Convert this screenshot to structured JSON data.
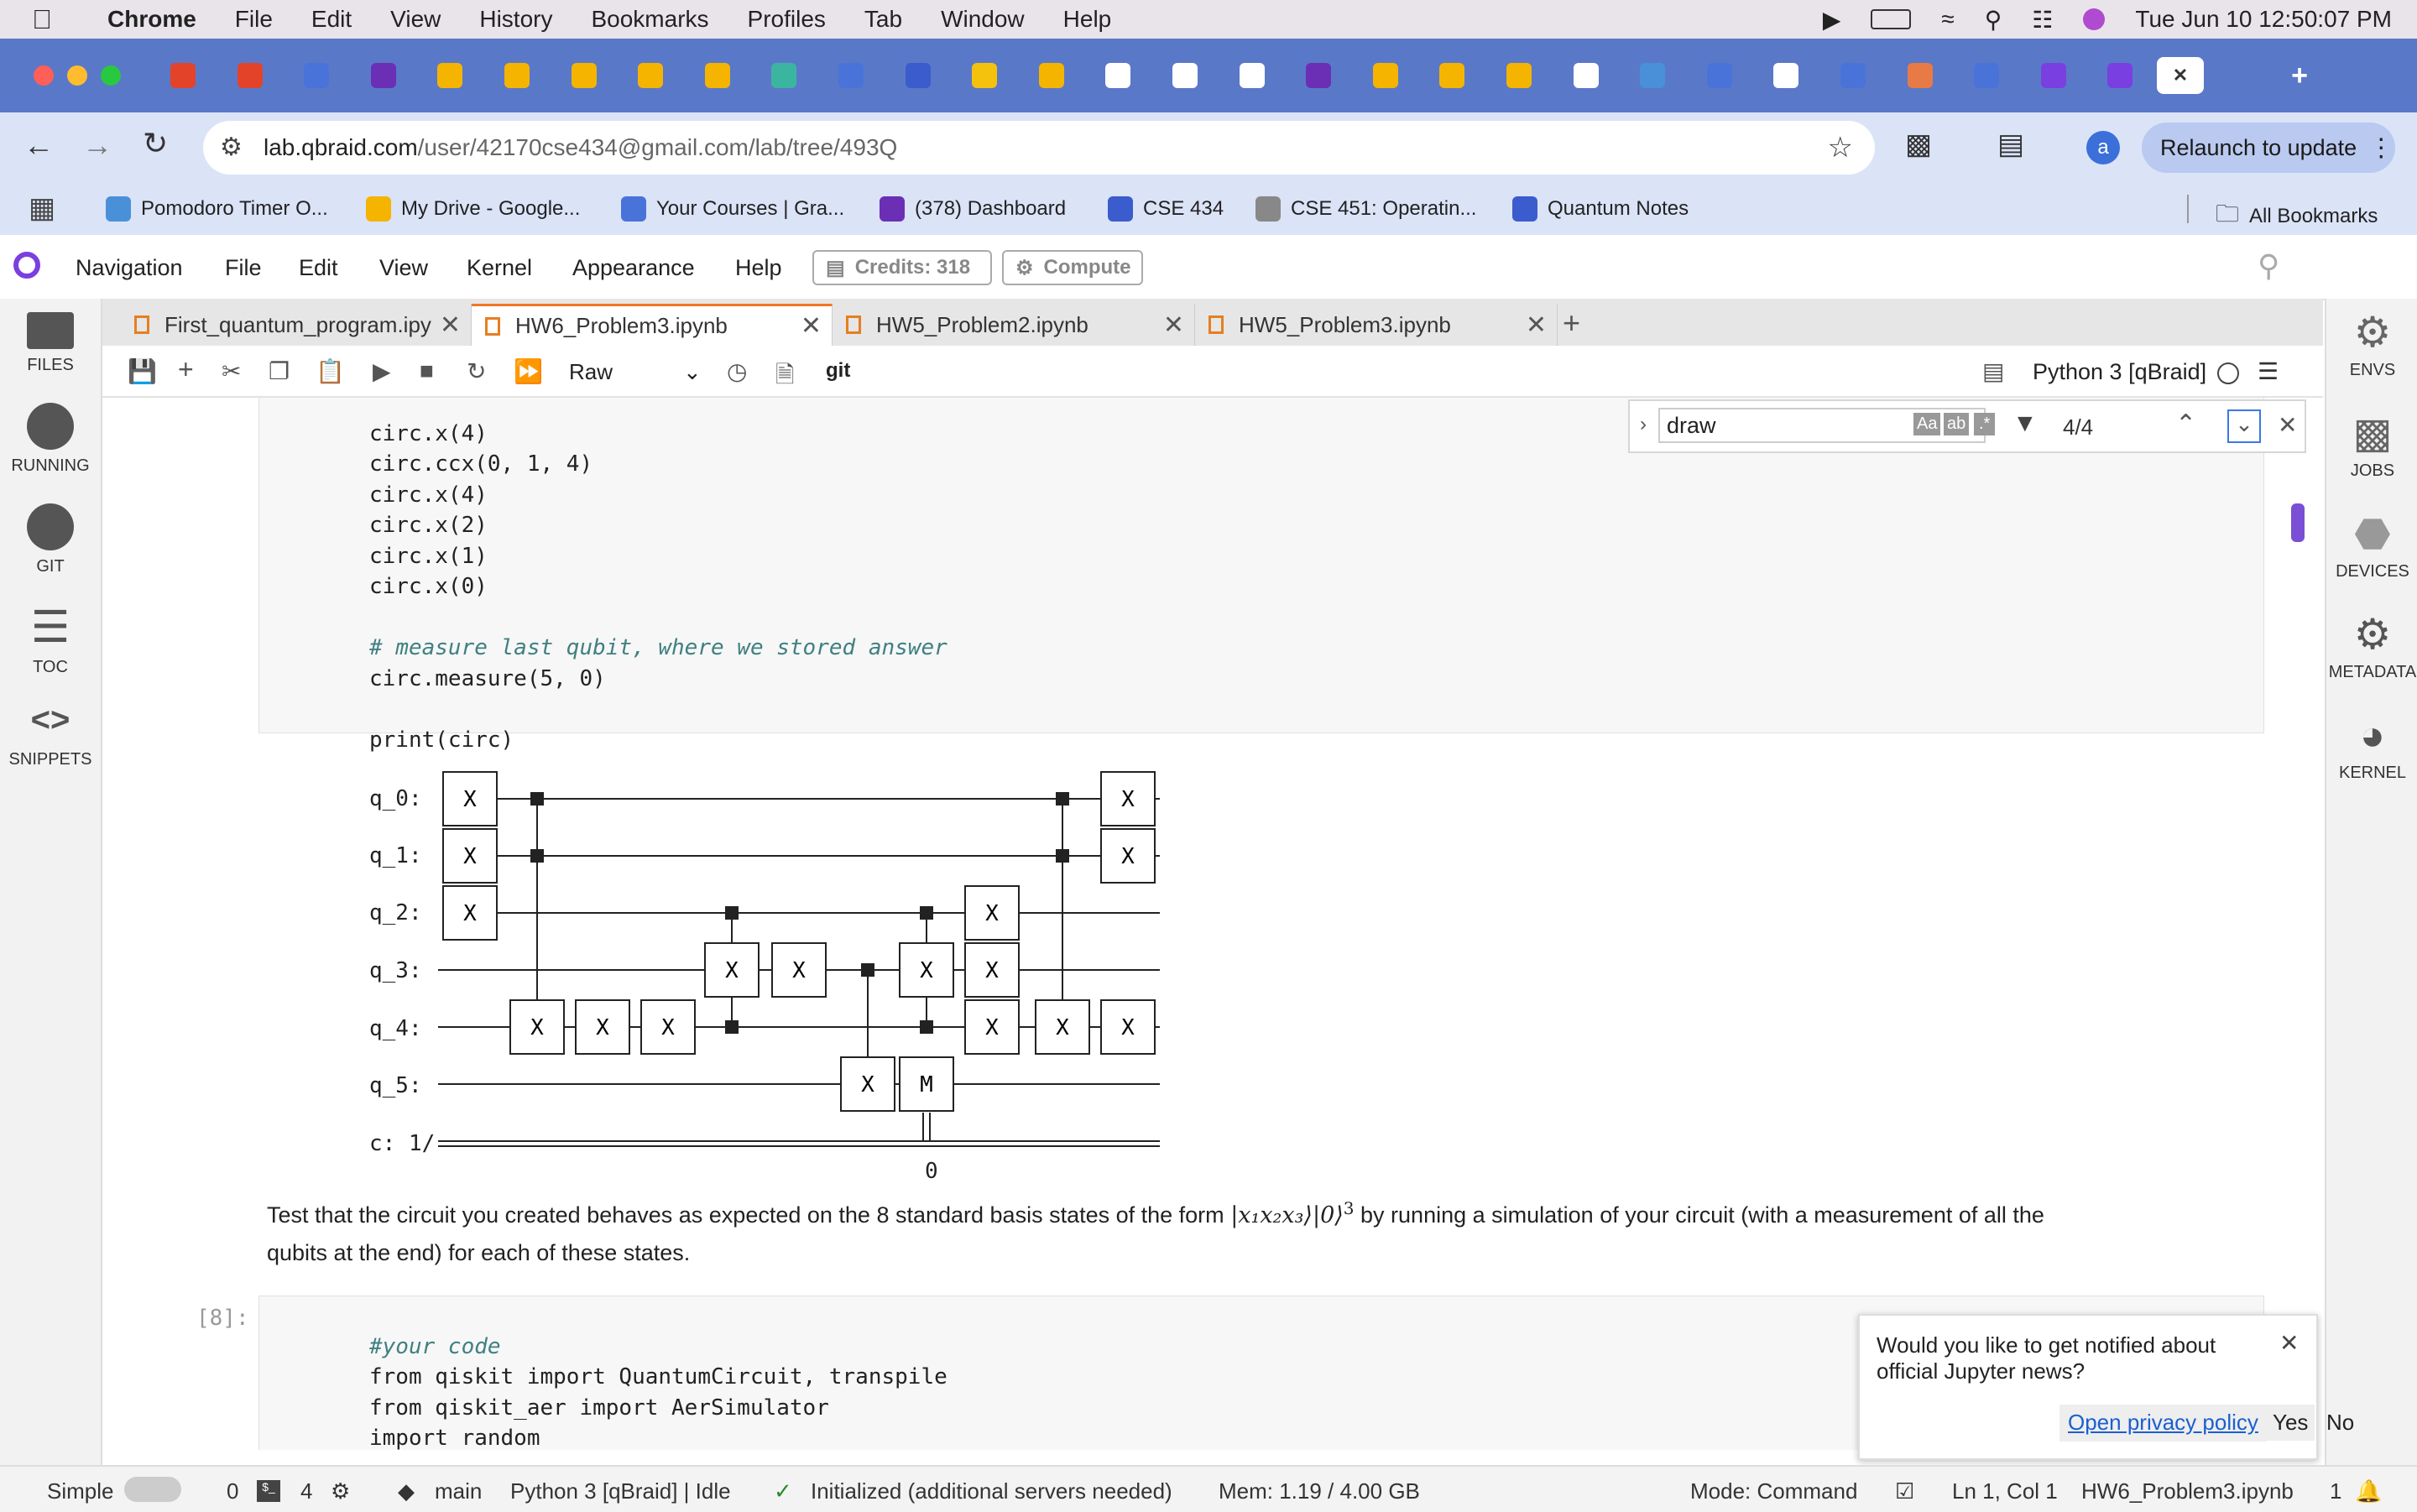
{
  "mac_menu": {
    "app": "Chrome",
    "items": [
      "File",
      "Edit",
      "View",
      "History",
      "Bookmarks",
      "Profiles",
      "Tab",
      "Window",
      "Help"
    ],
    "clock": "Tue Jun 10  12:50:07 PM"
  },
  "browser": {
    "url_host": "lab.qbraid.com",
    "url_path": "/user/42170cse434@gmail.com/lab/tree/493Q",
    "relaunch_label": "Relaunch to update",
    "avatar_letter": "a",
    "bookmarks": [
      {
        "label": "Pomodoro Timer O...",
        "color": "#4a90d9"
      },
      {
        "label": "My Drive - Google...",
        "color": "#f4b400"
      },
      {
        "label": "Your Courses | Gra...",
        "color": "#4a73d9"
      },
      {
        "label": "(378) Dashboard",
        "color": "#6b2fb5"
      },
      {
        "label": "CSE 434",
        "color": "#3b5ccc"
      },
      {
        "label": "CSE 451: Operatin...",
        "color": "#888888"
      },
      {
        "label": "Quantum Notes",
        "color": "#3b5ccc"
      }
    ],
    "all_bookmarks": "All Bookmarks"
  },
  "jupyter": {
    "menu": [
      "Navigation",
      "File",
      "Edit",
      "View",
      "Kernel",
      "Appearance",
      "Help"
    ],
    "credits_label": "Credits:",
    "credits_value": "318",
    "compute_label": "Compute",
    "left_sidebar": [
      "FILES",
      "RUNNING",
      "GIT",
      "TOC",
      "SNIPPETS"
    ],
    "right_sidebar": [
      "ENVS",
      "JOBS",
      "DEVICES",
      "METADATA",
      "KERNEL"
    ],
    "tabs": [
      {
        "label": "First_quantum_program.ipy",
        "active": false
      },
      {
        "label": "HW6_Problem3.ipynb",
        "active": true
      },
      {
        "label": "HW5_Problem2.ipynb",
        "active": false
      },
      {
        "label": "HW5_Problem3.ipynb",
        "active": false
      }
    ],
    "cell_type": "Raw",
    "git_label": "git",
    "kernel_name": "Python 3 [qBraid]",
    "find": {
      "query": "draw",
      "count": "4/4"
    }
  },
  "notebook": {
    "code_lines_top": [
      "circ.x(4)",
      "circ.ccx(0, 1, 4)",
      "circ.x(4)",
      "circ.x(2)",
      "circ.x(1)",
      "circ.x(0)",
      "",
      "# measure last qubit, where we stored answer",
      "circ.measure(5, 0)",
      "",
      "print(circ)"
    ],
    "circuit_labels": [
      "q_0:",
      "q_1:",
      "q_2:",
      "q_3:",
      "q_4:",
      "q_5:",
      "c: 1/"
    ],
    "classical_index": "0",
    "gate_x": "X",
    "gate_m": "M",
    "markdown": "Test that the circuit you created behaves as expected on the 8 standard basis states of the form",
    "math_state": "|x₁x₂x₃⟩|0⟩",
    "math_exp": "3",
    "markdown_tail": "by running a simulation of your circuit (with a measurement of all the",
    "markdown_line2": "qubits at the end) for each of these states.",
    "prompt": "[8]:",
    "code_lines_bottom": [
      "#your code",
      "from qiskit import QuantumCircuit, transpile",
      "from qiskit_aer import AerSimulator",
      "import random"
    ]
  },
  "notification": {
    "text": "Would you like to get notified about official Jupyter news?",
    "privacy": "Open privacy policy",
    "yes": "Yes",
    "no": "No"
  },
  "statusbar": {
    "mode_toggle": "Simple",
    "terminals": "0",
    "kernels": "4",
    "branch": "main",
    "kernel_status": "Python 3 [qBraid] | Idle",
    "servers": "Initialized (additional servers needed)",
    "mem": "Mem: 1.19 / 4.00 GB",
    "mode": "Mode: Command",
    "position": "Ln 1, Col 1",
    "file": "HW6_Problem3.ipynb",
    "notifications": "1"
  }
}
